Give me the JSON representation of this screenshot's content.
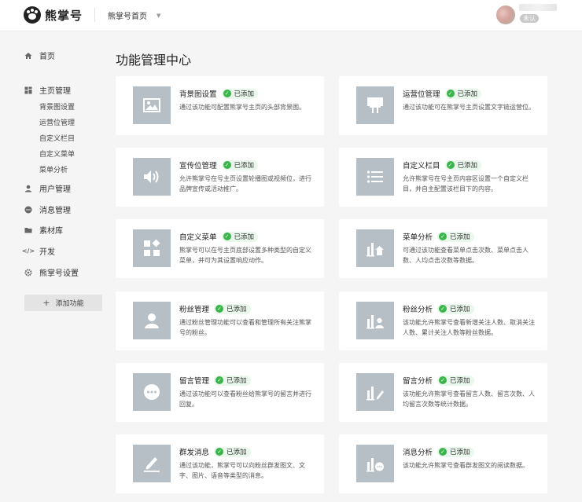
{
  "header": {
    "logo_text": "熊掌号",
    "home_select": "熊掌号首页",
    "user_badge": "未认"
  },
  "sidebar": {
    "home": "首页",
    "homepage_mgmt": "主页管理",
    "sub_items": [
      "背景图设置",
      "运营位管理",
      "自定义栏目",
      "自定义菜单",
      "菜单分析"
    ],
    "users": "用户管理",
    "messages": "消息管理",
    "materials": "素材库",
    "dev": "开发",
    "settings": "熊掌号设置",
    "add_label": "添加功能"
  },
  "main": {
    "title": "功能管理中心",
    "badge_label": "已添加",
    "cards": [
      {
        "title": "背景图设置",
        "desc": "通过该功能可配置熊掌号主页的头部背景图。",
        "icon": "image-icon"
      },
      {
        "title": "运营位管理",
        "desc": "通过该功能可在熊掌号主页设置文字链运营位。",
        "icon": "billboard-icon"
      },
      {
        "title": "宣传位管理",
        "desc": "允许熊掌号在号主页设置轮播图或视频位，进行品牌宣传或活动推广。",
        "icon": "speaker-icon"
      },
      {
        "title": "自定义栏目",
        "desc": "允许熊掌号在号主页内容区设置一个自定义栏目，并自主配置该栏目下的内容。",
        "icon": "list-icon"
      },
      {
        "title": "自定义菜单",
        "desc": "熊掌号可以在号主页底部设置多种类型的自定义菜单，并可为其设置响应动作。",
        "icon": "grid-icon"
      },
      {
        "title": "菜单分析",
        "desc": "可通过该功能查看菜单点击次数、菜单点击人数、人均点击次数等数据。",
        "icon": "chart-home-icon"
      },
      {
        "title": "粉丝管理",
        "desc": "通过粉丝管理功能可以查看和管理所有关注熊掌号的粉丝。",
        "icon": "user-icon"
      },
      {
        "title": "粉丝分析",
        "desc": "该功能允许熊掌号查看新增关注人数、取消关注人数、累计关注人数等粉丝数据。",
        "icon": "chart-user-icon"
      },
      {
        "title": "留言管理",
        "desc": "通过该功能可以查看粉丝给熊掌号的留言并进行回复。",
        "icon": "comment-icon"
      },
      {
        "title": "留言分析",
        "desc": "该功能允许熊掌号查看留言人数、留言次数、人均留言次数等统计数据。",
        "icon": "chart-pen-icon"
      },
      {
        "title": "群发消息",
        "desc": "通过该功能，熊掌号可以向粉丝群发图文、文字、图片、语音等类型的消息。",
        "icon": "edit-icon"
      },
      {
        "title": "消息分析",
        "desc": "该功能允许熊掌号查看群发图文的阅读数据。",
        "icon": "chart-message-icon"
      }
    ]
  }
}
